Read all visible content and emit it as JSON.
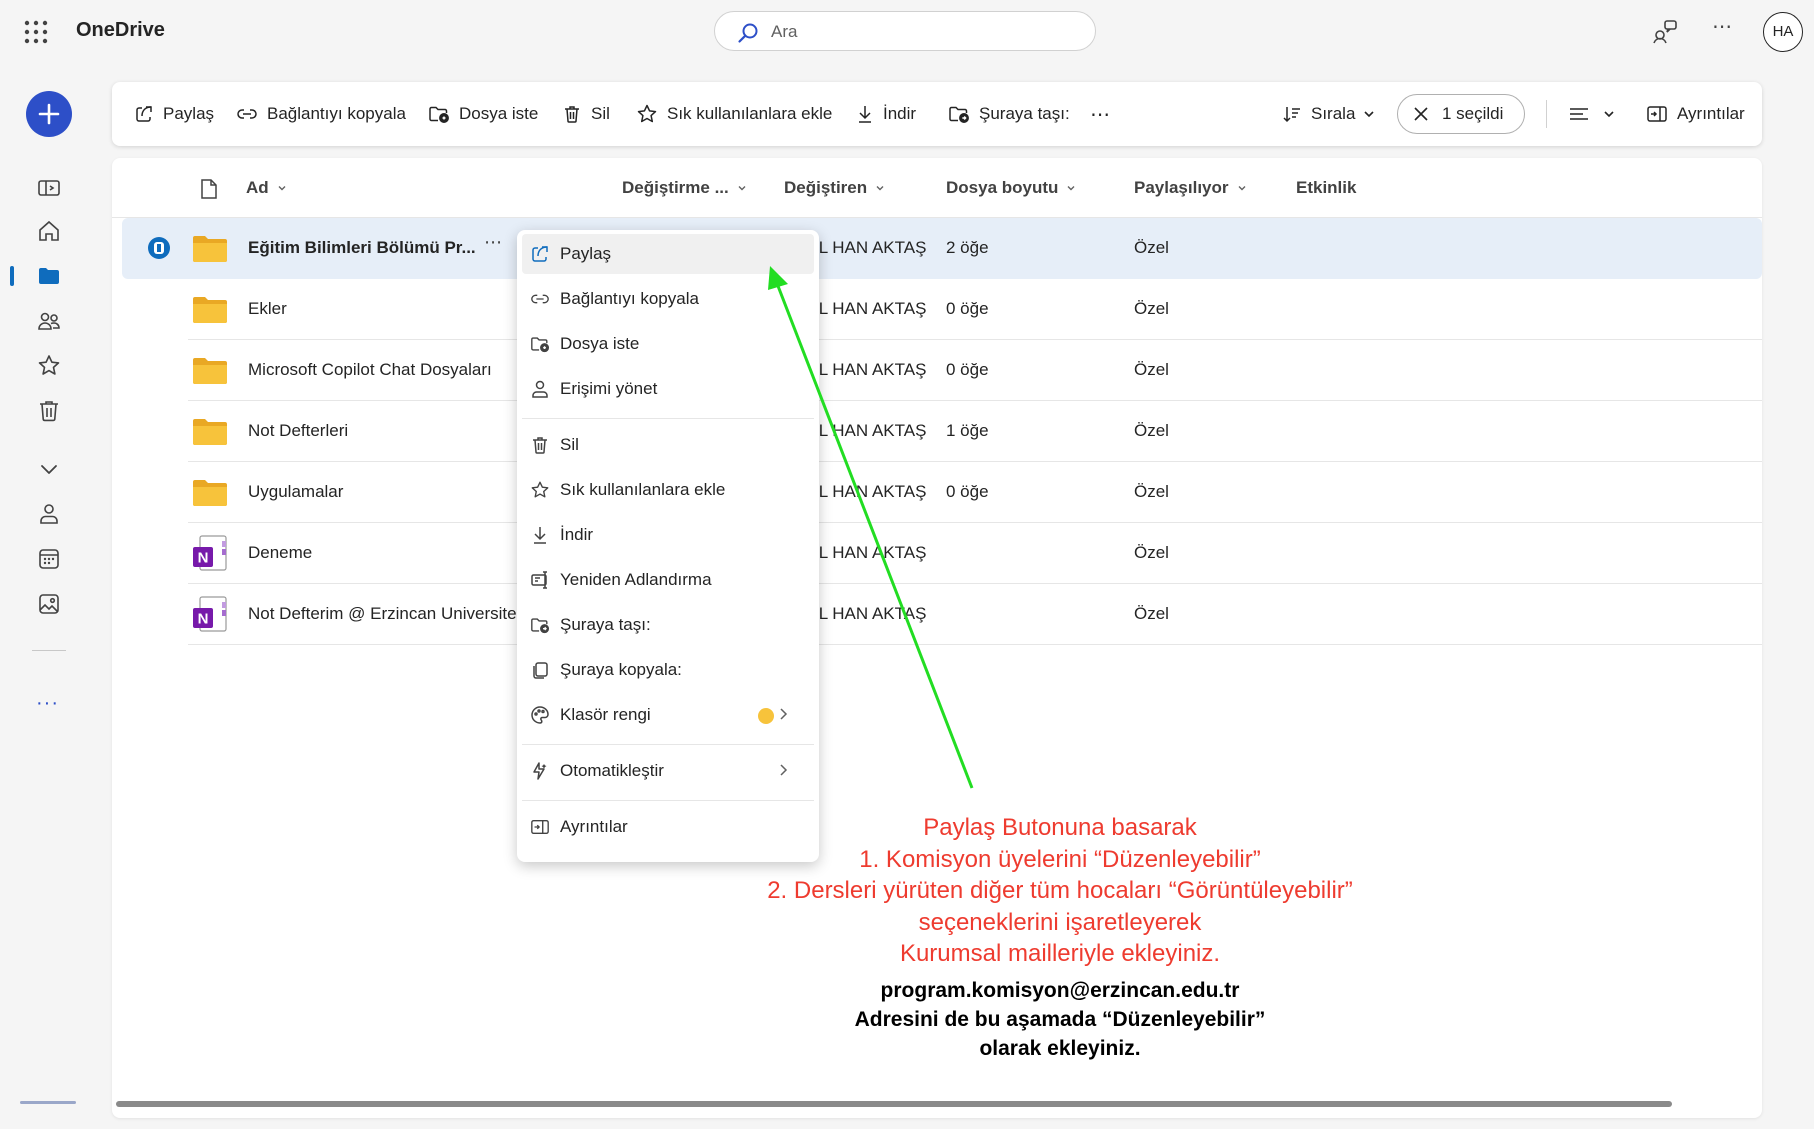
{
  "app": {
    "title": "OneDrive"
  },
  "search": {
    "placeholder": "Ara"
  },
  "avatar": {
    "initials": "HA"
  },
  "colors": {
    "accent": "#0f6cbd",
    "fab": "#2d4fc8",
    "folder": "#f7c33b",
    "annotation_red": "#ee3b2f",
    "annotation_arrow": "#22dd22",
    "onenote": "#7719aa"
  },
  "rail": {
    "icons": [
      "toggle-nav-icon",
      "home-icon",
      "my-files-icon",
      "shared-icon",
      "favorites-icon",
      "recycle-bin-icon",
      "expand-chevron-icon",
      "people-icon",
      "meetings-icon",
      "photos-icon",
      "more-icon"
    ]
  },
  "toolbar": {
    "share": "Paylaş",
    "copy_link": "Bağlantıyı kopyala",
    "request_files": "Dosya iste",
    "delete": "Sil",
    "add_favorites": "Sık kullanılanlara ekle",
    "download": "İndir",
    "move_to": "Şuraya taşı:",
    "more": "⋯",
    "sort": "Sırala",
    "selected": "1 seçildi",
    "details": "Ayrıntılar"
  },
  "columns": {
    "name": "Ad",
    "modified": "Değiştirme ...",
    "modified_by": "Değiştiren",
    "file_size": "Dosya boyutu",
    "sharing": "Paylaşılıyor",
    "activity": "Etkinlik"
  },
  "rows": [
    {
      "name": "Eğitim Bilimleri Bölümü Pr...",
      "type": "folder",
      "modified_by": "İL HAN AKTAŞ",
      "size": "2 öğe",
      "sharing": "Özel",
      "selected": true
    },
    {
      "name": "Ekler",
      "type": "folder",
      "modified_by": "İL HAN AKTAŞ",
      "size": "0 öğe",
      "sharing": "Özel"
    },
    {
      "name": "Microsoft Copilot Chat Dosyaları",
      "type": "folder",
      "modified_by": "İL HAN AKTAŞ",
      "size": "0 öğe",
      "sharing": "Özel"
    },
    {
      "name": "Not Defterleri",
      "type": "folder",
      "modified_by": "İL HAN AKTAŞ",
      "size": "1 öğe",
      "sharing": "Özel"
    },
    {
      "name": "Uygulamalar",
      "type": "folder",
      "modified_by": "İL HAN AKTAŞ",
      "size": "0 öğe",
      "sharing": "Özel"
    },
    {
      "name": "Deneme",
      "type": "onenote",
      "modified_by": "İL HAN AKTAŞ",
      "size": "",
      "sharing": "Özel"
    },
    {
      "name": "Not Defterim @ Erzincan Universite",
      "type": "onenote",
      "modified_by": "İL HAN AKTAŞ",
      "size": "",
      "sharing": "Özel"
    }
  ],
  "row_more": "⋯",
  "onenote_letter": "N",
  "context_menu": {
    "share": "Paylaş",
    "copy_link": "Bağlantıyı kopyala",
    "request_files": "Dosya iste",
    "manage_access": "Erişimi yönet",
    "delete": "Sil",
    "add_favorites": "Sık kullanılanlara ekle",
    "download": "İndir",
    "rename": "Yeniden Adlandırma",
    "move_to": "Şuraya taşı:",
    "copy_to": "Şuraya kopyala:",
    "folder_color": "Klasör rengi",
    "automate": "Otomatikleştir",
    "details": "Ayrıntılar"
  },
  "annotation": {
    "red_lines": [
      "Paylaş Butonuna basarak",
      "1. Komisyon üyelerini “Düzenleyebilir”",
      "2. Dersleri yürüten diğer tüm hocaları “Görüntüleyebilir”",
      "seçeneklerini işaretleyerek",
      "Kurumsal mailleriyle ekleyiniz."
    ],
    "black_lines": [
      "program.komisyon@erzincan.edu.tr",
      "Adresini de bu aşamada “Düzenleyebilir”",
      "olarak ekleyiniz."
    ]
  }
}
